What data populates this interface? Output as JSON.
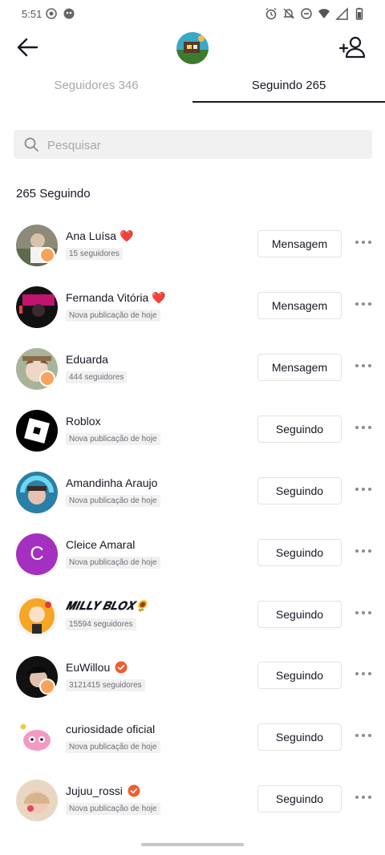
{
  "status_bar": {
    "time": "5:51"
  },
  "header": {
    "back_icon": "arrow-left-icon",
    "add_user_icon": "add-user-icon"
  },
  "tabs": [
    {
      "label": "Seguidores 346"
    },
    {
      "label": "Seguindo 265"
    }
  ],
  "search": {
    "placeholder": "Pesquisar",
    "value": ""
  },
  "count_label": "265 Seguindo",
  "users": [
    {
      "name": "Ana Luísa ❤️",
      "sub": "15 seguidores",
      "button": "Mensagem"
    },
    {
      "name": "Fernanda Vitória ❤️",
      "sub": "Nova publicação de hoje",
      "button": "Mensagem"
    },
    {
      "name": "Eduarda",
      "sub": "444 seguidores",
      "button": "Mensagem"
    },
    {
      "name": "Roblox",
      "sub": "Nova publicação de hoje",
      "button": "Seguindo"
    },
    {
      "name": "Amandinha Araujo",
      "sub": "Nova publicação de hoje",
      "button": "Seguindo"
    },
    {
      "name": "Cleice Amaral",
      "sub": "Nova publicação de hoje",
      "button": "Seguindo",
      "initial": "C"
    },
    {
      "name": "𝑴𝑰𝑳𝑳𝒀 𝑩𝑳𝑶𝑿🌻",
      "sub": "15594 seguidores",
      "button": "Seguindo"
    },
    {
      "name": "EuWillou",
      "sub": "3121415 seguidores",
      "button": "Seguindo"
    },
    {
      "name": "curiosidade oficial",
      "sub": "Nova publicação de hoje",
      "button": "Seguindo"
    },
    {
      "name": "Jujuu_rossi",
      "sub": "Nova publicação de hoje",
      "button": "Seguindo"
    }
  ],
  "colors": {
    "accent_verified": "#f25c2b",
    "purple_avatar": "#a52fc1",
    "badge": "#f7a35c"
  }
}
